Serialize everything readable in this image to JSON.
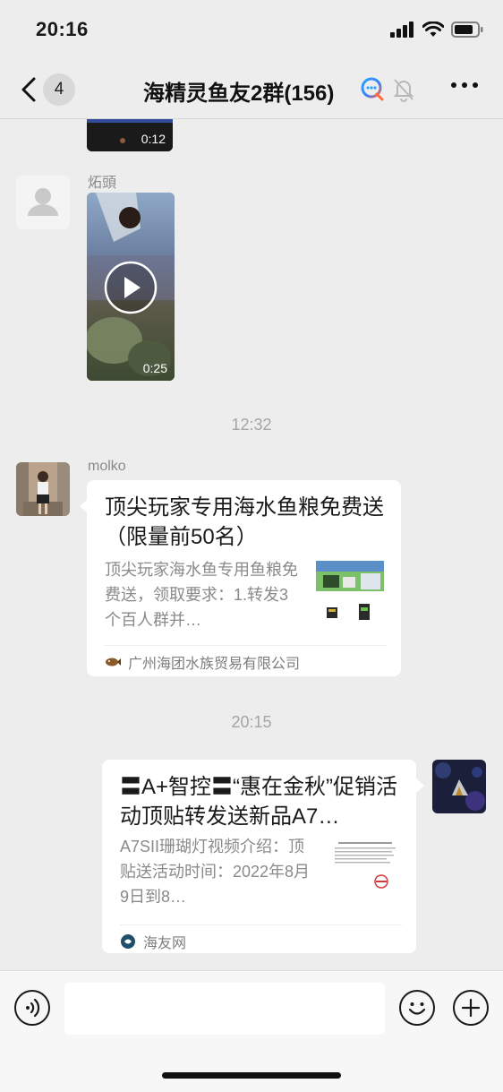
{
  "status_bar": {
    "time": "20:16"
  },
  "nav": {
    "unread_count": "4",
    "title": "海精灵鱼友2群(156)"
  },
  "messages": [
    {
      "type": "video",
      "duration": "0:12"
    },
    {
      "type": "video",
      "sender": "炻頭",
      "duration": "0:25"
    },
    {
      "type": "timestamp",
      "text": "12:32"
    },
    {
      "type": "link_card",
      "sender": "molko",
      "title": "顶尖玩家专用海水鱼粮免费送（限量前50名）",
      "description": "顶尖玩家海水鱼专用鱼粮免费送，领取要求：1.转发3个百人群并…",
      "source": "广州海团水族贸易有限公司"
    },
    {
      "type": "timestamp",
      "text": "20:15"
    },
    {
      "type": "link_card",
      "sender": "self",
      "title": "〓A+智控〓“惠在金秋”促销活动顶贴转发送新品A7…",
      "description": "A7SII珊瑚灯视频介绍：顶贴送活动时间：2022年8月9日到8…",
      "source": "海友网"
    }
  ],
  "colors": {
    "background": "#ededed",
    "card": "#ffffff",
    "muted_text": "#8a8a8a"
  }
}
